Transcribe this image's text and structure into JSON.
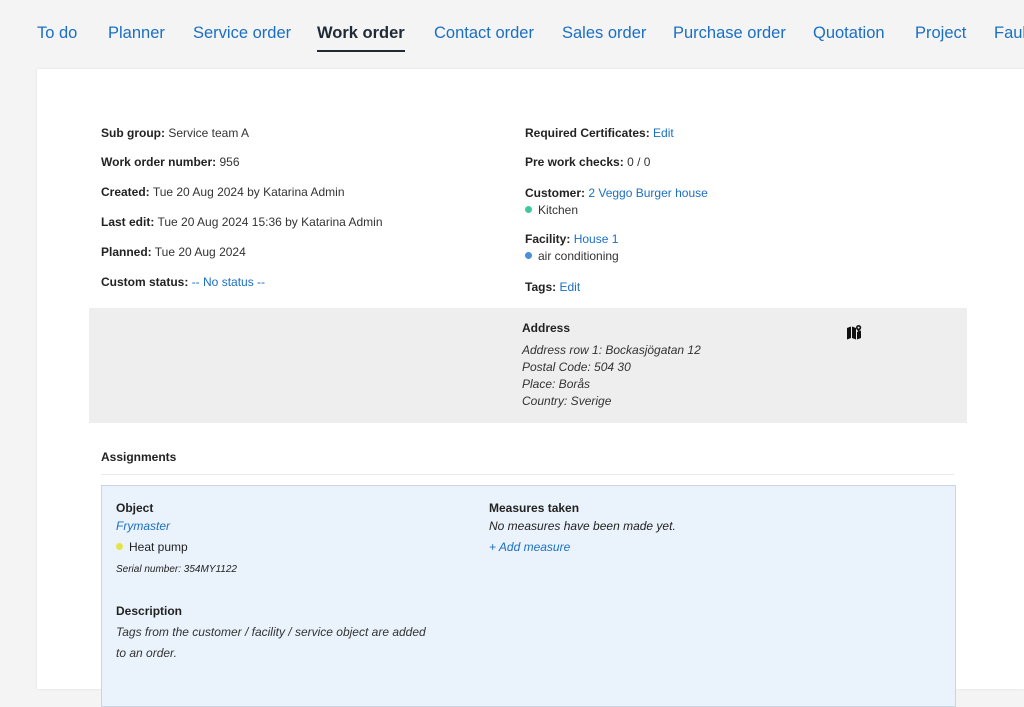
{
  "nav": {
    "tabs": [
      {
        "label": "To do"
      },
      {
        "label": "Planner"
      },
      {
        "label": "Service order"
      },
      {
        "label": "Work order",
        "active": true
      },
      {
        "label": "Contact order"
      },
      {
        "label": "Sales order"
      },
      {
        "label": "Purchase order"
      },
      {
        "label": "Quotation"
      },
      {
        "label": "Project"
      },
      {
        "label": "Faul"
      }
    ]
  },
  "details_left": {
    "sub_group_label": "Sub group:",
    "sub_group_value": "Service team A",
    "wo_number_label": "Work order number:",
    "wo_number_value": "956",
    "created_label": "Created:",
    "created_value": "Tue 20 Aug 2024 by Katarina Admin",
    "last_edit_label": "Last edit:",
    "last_edit_value": "Tue 20 Aug 2024 15:36 by Katarina Admin",
    "planned_label": "Planned:",
    "planned_value": "Tue 20 Aug 2024",
    "custom_status_label": "Custom status:",
    "custom_status_value": "-- No status --"
  },
  "details_right": {
    "certs_label": "Required Certificates:",
    "certs_link": "Edit",
    "prework_label": "Pre work checks:",
    "prework_value": "0 / 0",
    "customer_label": "Customer:",
    "customer_value": "2 Veggo Burger house",
    "customer_tag": "Kitchen",
    "facility_label": "Facility:",
    "facility_value": "House 1",
    "facility_tag": "air conditioning",
    "tags_label": "Tags:",
    "tags_link": "Edit"
  },
  "address": {
    "title": "Address",
    "row1": "Address row 1: Bockasjögatan 12",
    "postal": "Postal Code: 504 30",
    "place": "Place: Borås",
    "country": "Country: Sverige"
  },
  "assignments": {
    "title": "Assignments",
    "object_label": "Object",
    "object_name": "Frymaster",
    "object_type": "Heat pump",
    "serial": "Serial number: 354MY1122",
    "measures_label": "Measures taken",
    "measures_empty": "No measures have been made yet.",
    "add_measure": "+ Add measure",
    "description_label": "Description",
    "description_text": "Tags from the customer / facility / service object are added to an order."
  },
  "colors": {
    "link": "#1a6fc4",
    "kitchen_dot": "#3fc7a0",
    "facility_dot": "#4a90d9",
    "object_dot": "#e4e44a"
  },
  "icons": {
    "map": "map-pin-icon"
  }
}
